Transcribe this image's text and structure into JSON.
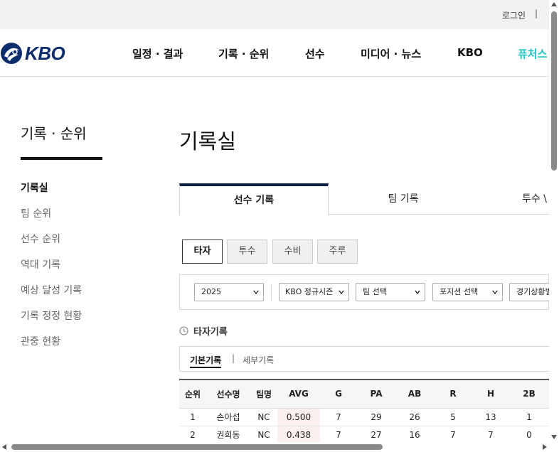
{
  "topbar": {
    "login": "로그인",
    "separator": "|"
  },
  "header": {
    "logo_text": "KBO",
    "nav": [
      "일정 · 결과",
      "기록 · 순위",
      "선수",
      "미디어 · 뉴스",
      "KBO",
      "퓨처스"
    ],
    "accent_color": "#22c3c0",
    "brand_color": "#0b2d6b"
  },
  "sidebar": {
    "title": "기록 · 순위",
    "items": [
      {
        "label": "기록실",
        "active": true
      },
      {
        "label": "팀 순위"
      },
      {
        "label": "선수 순위"
      },
      {
        "label": "역대 기록"
      },
      {
        "label": "예상 달성 기록"
      },
      {
        "label": "기록 정정 현황"
      },
      {
        "label": "관중 현황"
      }
    ]
  },
  "main": {
    "title": "기록실",
    "tabs": [
      "선수 기록",
      "팀 기록",
      "투수 \\"
    ],
    "pills": [
      "타자",
      "투수",
      "수비",
      "주루"
    ],
    "filters": {
      "season": "2025",
      "series": "KBO 정규시즌",
      "team": "팀 선택",
      "position": "포지션 선택",
      "situation": "경기상황별"
    },
    "section_title": "타자기록",
    "subtabs": {
      "basic": "기본기록",
      "separator": "|",
      "detail": "세부기록"
    },
    "table": {
      "headers": [
        "순위",
        "선수명",
        "팀명",
        "AVG",
        "G",
        "PA",
        "AB",
        "R",
        "H",
        "2B"
      ],
      "rows": [
        [
          "1",
          "손아섭",
          "NC",
          "0.500",
          "7",
          "29",
          "26",
          "5",
          "13",
          "1"
        ],
        [
          "2",
          "권희동",
          "NC",
          "0.438",
          "7",
          "27",
          "16",
          "7",
          "7",
          "0"
        ]
      ]
    }
  }
}
